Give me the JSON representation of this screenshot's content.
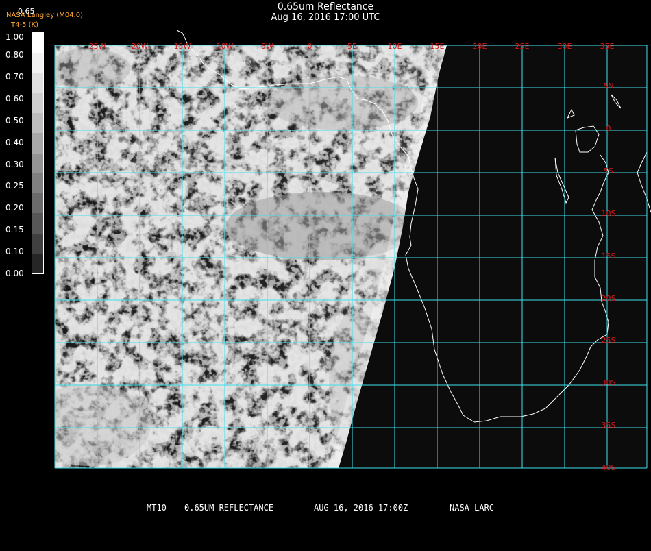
{
  "header": {
    "title": "0.65um Reflectance",
    "subtitle": "Aug 16, 2016 17:00 UTC",
    "credit": "NASA Langley (M04.0)",
    "credit_sub": "T4-5 (K)"
  },
  "colorbar": {
    "title": "0.65",
    "labels": [
      "1.00",
      "0.80",
      "0.70",
      "0.60",
      "0.50",
      "0.40",
      "0.30",
      "0.25",
      "0.20",
      "0.15",
      "0.10",
      "0.00"
    ],
    "colors": [
      "#ffffff",
      "#f2f2f2",
      "#e0e0e0",
      "#cfcfcf",
      "#bdbdbd",
      "#a8a8a8",
      "#949494",
      "#808080",
      "#6b6b6b",
      "#575757",
      "#404040",
      "#262626"
    ]
  },
  "map": {
    "lon_labels": [
      "25W",
      "20W",
      "15W",
      "10W",
      "5W",
      "0",
      "5E",
      "10E",
      "15E",
      "20E",
      "25E",
      "30E",
      "35E"
    ],
    "lat_labels": [
      "5N",
      "0",
      "5S",
      "10S",
      "15S",
      "20S",
      "25S",
      "30S",
      "35S",
      "40S"
    ],
    "grid_color": "#40e0f0",
    "label_color": "#d01818",
    "coast_color": "#ffffff"
  },
  "footer": {
    "product": "MT10",
    "field": "0.65UM REFLECTANCE",
    "datetime": "AUG 16, 2016 17:00Z",
    "source": "NASA LARC"
  }
}
